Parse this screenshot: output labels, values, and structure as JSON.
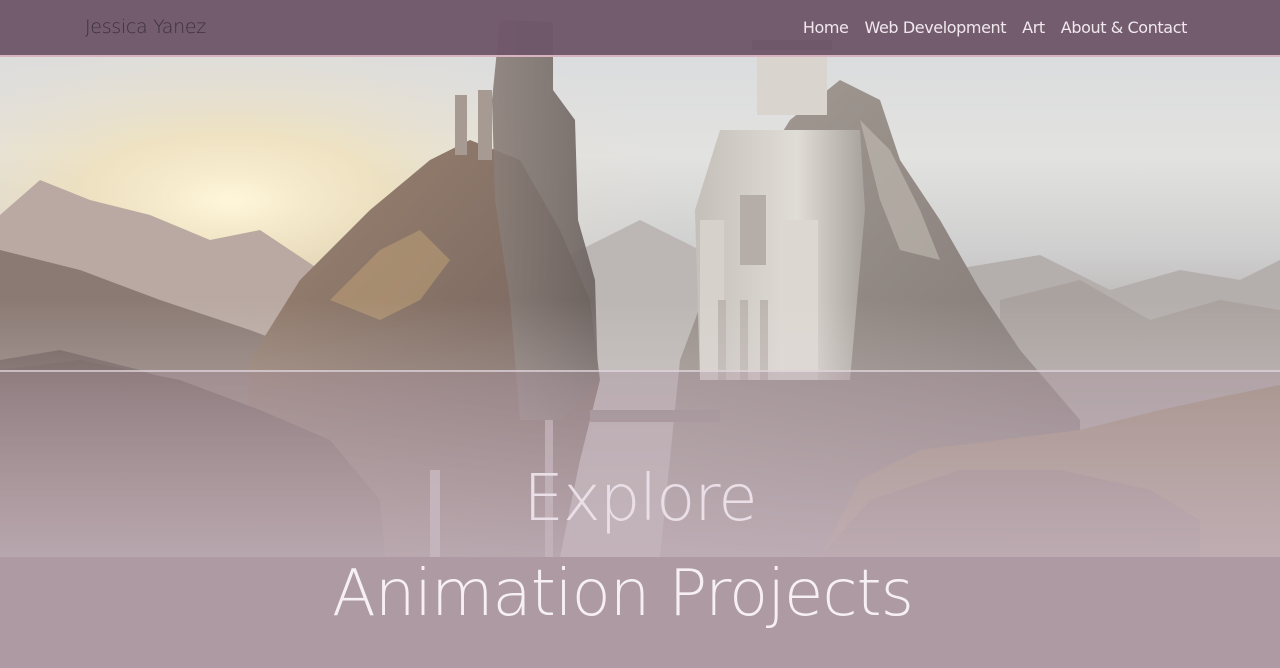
{
  "site": {
    "brand": "Jessica Yanez"
  },
  "nav": {
    "items": [
      {
        "label": "Home"
      },
      {
        "label": "Web Development"
      },
      {
        "label": "Art"
      },
      {
        "label": "About & Contact"
      }
    ]
  },
  "hero": {
    "heading": "Explore"
  },
  "section": {
    "title": "Animation Projects"
  },
  "colors": {
    "navbar": "#6f566a",
    "navbar_border": "#d7b4bf",
    "section_bar": "#ae9aa3",
    "text_light": "#f1e8ee"
  }
}
